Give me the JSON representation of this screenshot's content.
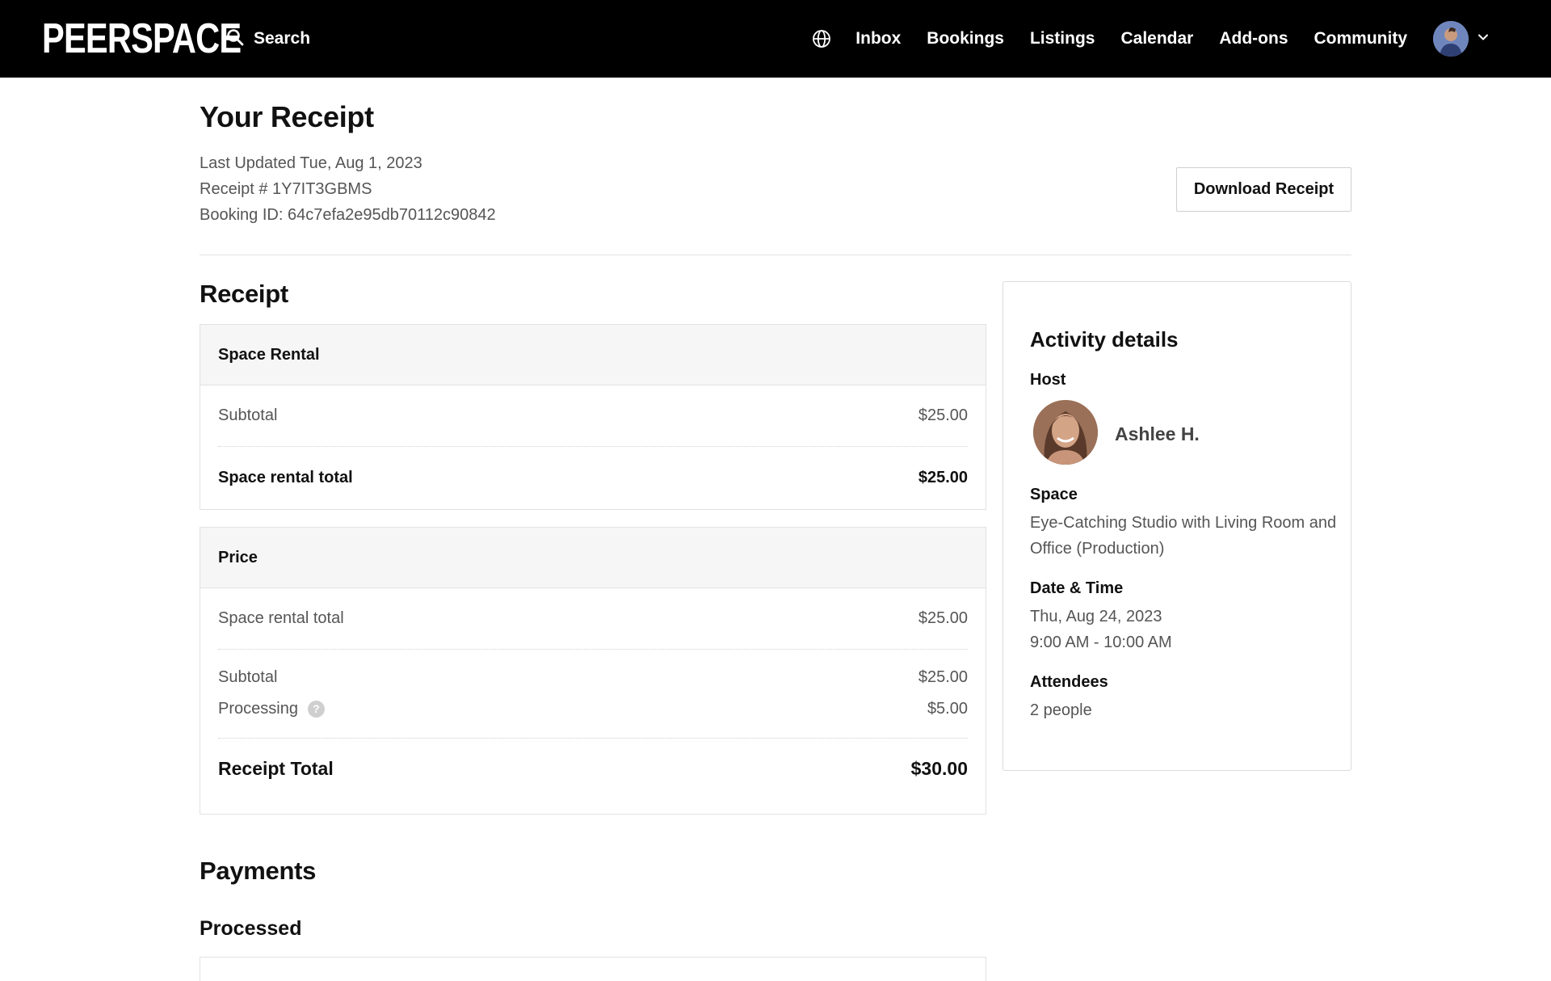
{
  "brand": {
    "logo_text": "PEERSPACE",
    "nav_bg": "#000000",
    "accent": "#111111"
  },
  "nav": {
    "search_label": "Search",
    "search_icon": "search-icon",
    "globe_icon": "globe-icon",
    "links": [
      "Inbox",
      "Bookings",
      "Listings",
      "Calendar",
      "Add-ons",
      "Community"
    ],
    "avatar_icon": "user-avatar",
    "dropdown_icon": "chevron-down-icon"
  },
  "header": {
    "title": "Your Receipt",
    "last_updated": "Last Updated Tue, Aug 1, 2023",
    "receipt_number": "Receipt # 1Y7IT3GBMS",
    "booking_id": "Booking ID: 64c7efa2e95db70112c90842",
    "download_label": "Download Receipt"
  },
  "receipt": {
    "title": "Receipt",
    "space_rental": {
      "heading": "Space Rental",
      "subtotal_label": "Subtotal",
      "subtotal_value": "$25.00",
      "total_label": "Space rental total",
      "total_value": "$25.00"
    },
    "price": {
      "heading": "Price",
      "space_rental_total_label": "Space rental total",
      "space_rental_total_value": "$25.00",
      "subtotal_label": "Subtotal",
      "subtotal_value": "$25.00",
      "processing_label": "Processing",
      "processing_help": "?",
      "processing_value": "$5.00",
      "receipt_total_label": "Receipt Total",
      "receipt_total_value": "$30.00"
    }
  },
  "activity": {
    "title": "Activity details",
    "host_label": "Host",
    "host_name": "Ashlee H.",
    "space_label": "Space",
    "space_name": "Eye-Catching Studio with Living Room and Office (Production)",
    "datetime_label": "Date & Time",
    "date": "Thu, Aug 24, 2023",
    "time": "9:00 AM - 10:00 AM",
    "attendees_label": "Attendees",
    "attendees": "2 people"
  },
  "payments": {
    "title": "Payments",
    "processed_label": "Processed"
  }
}
